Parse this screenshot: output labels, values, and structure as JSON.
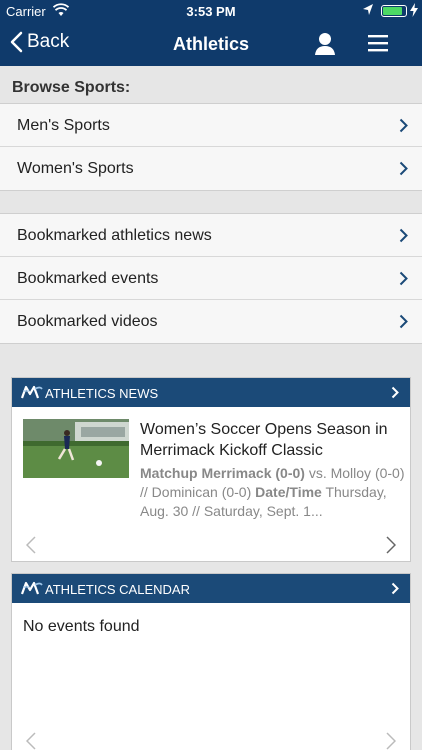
{
  "status_bar": {
    "carrier": "Carrier",
    "time": "3:53 PM",
    "battery_level": 0.9,
    "battery_color": "#4cd964"
  },
  "nav": {
    "back_label": "Back",
    "title": "Athletics",
    "icons": [
      "chevron-left-icon",
      "person-icon",
      "hamburger-menu-icon"
    ]
  },
  "browse": {
    "header": "Browse Sports:",
    "items": [
      {
        "label": "Men's Sports"
      },
      {
        "label": "Women's Sports"
      }
    ]
  },
  "bookmarks": {
    "items": [
      {
        "label": "Bookmarked athletics news"
      },
      {
        "label": "Bookmarked events"
      },
      {
        "label": "Bookmarked videos"
      }
    ]
  },
  "news_card": {
    "title": "ATHLETICS NEWS",
    "article": {
      "headline": "Women’s Soccer Opens Season in Merrimack Kickoff Classic",
      "desc_bold1": "Matchup Merrimack (0-0)",
      "desc_text1": " vs. Molloy (0-0) // Dominican (0-0) ",
      "desc_bold2": "Date/Time",
      "desc_text2": " Thursday, Aug. 30 // Saturday, Sept. 1..."
    }
  },
  "calendar_card": {
    "title": "ATHLETICS CALENDAR",
    "empty_text": "No events found"
  },
  "colors": {
    "nav_bg": "#0f3a6b",
    "card_header_bg": "#1b4a78",
    "page_bg": "#e6e6e6"
  }
}
